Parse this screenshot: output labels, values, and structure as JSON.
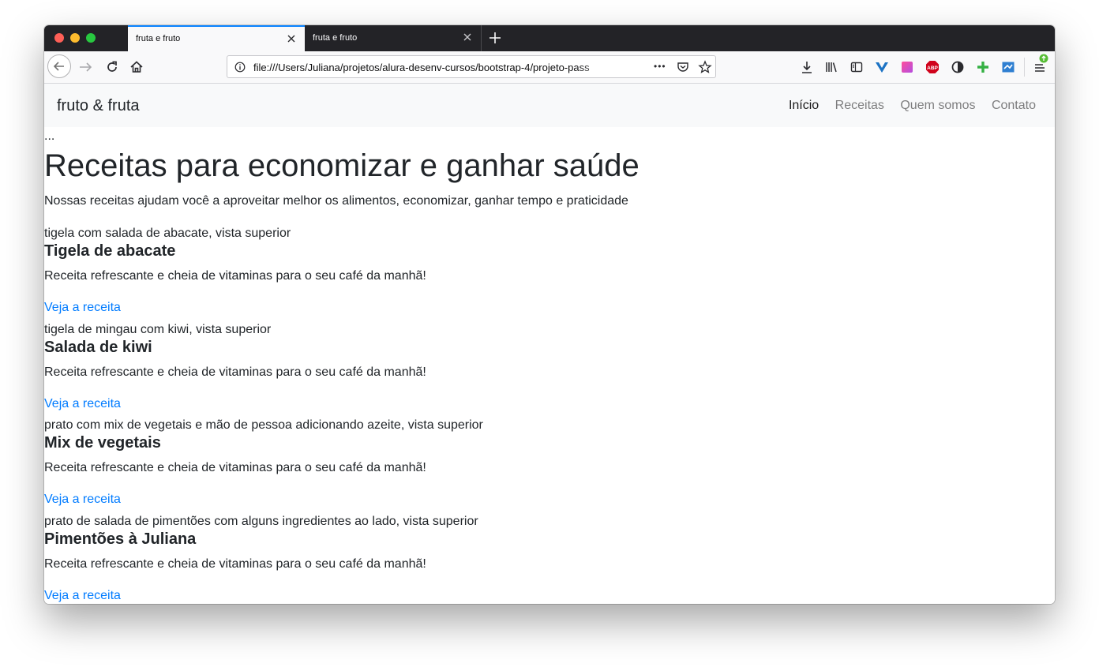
{
  "tabs": [
    {
      "title": "fruta e fruto"
    },
    {
      "title": "fruta e fruto"
    }
  ],
  "urlbar": {
    "url": "file:///Users/Juliana/projetos/alura-desenv-cursos/bootstrap-4/projeto-pass"
  },
  "toolbar": {
    "more": "•••"
  },
  "site": {
    "brand": "fruto & fruta",
    "nav": [
      "Início",
      "Receitas",
      "Quem somos",
      "Contato"
    ]
  },
  "content": {
    "ellipsis": "...",
    "title": "Receitas para economizar e ganhar saúde",
    "lead": "Nossas receitas ajudam você a aproveitar melhor os alimentos, economizar, ganhar tempo e praticidade",
    "recipes": [
      {
        "alt": "tigela com salada de abacate, vista superior",
        "title": "Tigela de abacate",
        "desc": "Receita refrescante e cheia de vitaminas para o seu café da manhã!",
        "link": "Veja a receita"
      },
      {
        "alt": "tigela de mingau com kiwi, vista superior",
        "title": "Salada de kiwi",
        "desc": "Receita refrescante e cheia de vitaminas para o seu café da manhã!",
        "link": "Veja a receita"
      },
      {
        "alt": "prato com mix de vegetais e mão de pessoa adicionando azeite, vista superior",
        "title": "Mix de vegetais",
        "desc": "Receita refrescante e cheia de vitaminas para o seu café da manhã!",
        "link": "Veja a receita"
      },
      {
        "alt": "prato de salada de pimentões com alguns ingredientes ao lado, vista superior",
        "title": "Pimentões à Juliana",
        "desc": "Receita refrescante e cheia de vitaminas para o seu café da manhã!",
        "link": "Veja a receita"
      }
    ]
  },
  "colors": {
    "link": "#007bff",
    "text": "#212529",
    "accent": "#0a84ff",
    "navbar": "#f8f9fa"
  }
}
